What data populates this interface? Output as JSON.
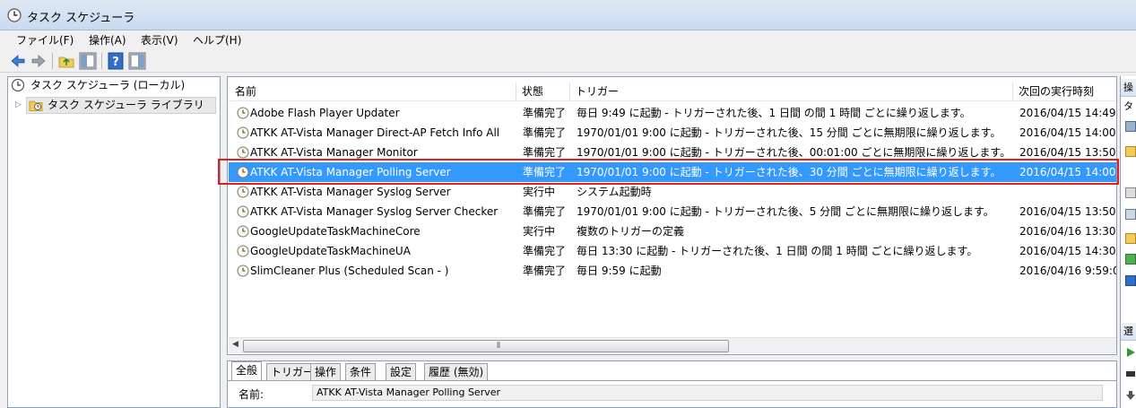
{
  "window": {
    "title": "タスク スケジューラ"
  },
  "menu": [
    "ファイル(F)",
    "操作(A)",
    "表示(V)",
    "ヘルプ(H)"
  ],
  "toolbar": [
    "back-icon",
    "forward-icon",
    "up-folder-icon",
    "show-hide-console-tree-icon",
    "help-icon",
    "show-hide-action-pane-icon"
  ],
  "tree": {
    "root": "タスク スケジューラ (ローカル)",
    "library": "タスク スケジューラ ライブラリ"
  },
  "columns": {
    "name": "名前",
    "status": "状態",
    "trigger": "トリガー",
    "next_run": "次回の実行時刻"
  },
  "tasks": [
    {
      "name": "Adobe Flash Player Updater",
      "status": "準備完了",
      "trigger": "毎日 9:49 に起動 - トリガーされた後、1 日間 の間 1 時間 ごとに繰り返します。",
      "next_run": "2016/04/15 14:49"
    },
    {
      "name": "ATKK AT-Vista Manager Direct-AP Fetch Info All",
      "status": "準備完了",
      "trigger": "1970/01/01 9:00 に起動 - トリガーされた後、15 分間 ごとに無期限に繰り返します。",
      "next_run": "2016/04/15 14:00"
    },
    {
      "name": "ATKK AT-Vista Manager Monitor",
      "status": "準備完了",
      "trigger": "1970/01/01 9:00 に起動 - トリガーされた後、00:01:00 ごとに無期限に繰り返します。",
      "next_run": "2016/04/15 13:50"
    },
    {
      "name": "ATKK AT-Vista Manager Polling Server",
      "status": "準備完了",
      "trigger": "1970/01/01 9:00 に起動 - トリガーされた後、30 分間 ごとに無期限に繰り返します。",
      "next_run": "2016/04/15 14:00"
    },
    {
      "name": "ATKK AT-Vista Manager Syslog Server",
      "status": "実行中",
      "trigger": "システム起動時",
      "next_run": ""
    },
    {
      "name": "ATKK AT-Vista Manager Syslog Server Checker",
      "status": "準備完了",
      "trigger": "1970/01/01 9:00 に起動 - トリガーされた後、5 分間 ごとに無期限に繰り返します。",
      "next_run": "2016/04/15 13:50"
    },
    {
      "name": "GoogleUpdateTaskMachineCore",
      "status": "実行中",
      "trigger": "複数のトリガーの定義",
      "next_run": "2016/04/16 13:30"
    },
    {
      "name": "GoogleUpdateTaskMachineUA",
      "status": "準備完了",
      "trigger": "毎日 13:30 に起動 - トリガーされた後、1 日間 の間 1 時間 ごとに繰り返します。",
      "next_run": "2016/04/15 14:30"
    },
    {
      "name": "SlimCleaner Plus (Scheduled Scan -          )",
      "status": "準備完了",
      "trigger": "毎日 9:59 に起動",
      "next_run": "2016/04/16 9:59:0"
    }
  ],
  "selected_task": "ATKK AT-Vista Manager Polling Server",
  "detail": {
    "tabs": [
      "全般",
      "トリガー",
      "操作",
      "条件",
      "設定",
      "履歴 (無効)"
    ],
    "active_tab": "全般",
    "name_label": "名前:",
    "name_value": "ATKK AT-Vista Manager Polling Server"
  },
  "actions_pane": {
    "header_1": "操",
    "header_2": "タ",
    "header_3": "選"
  },
  "colors": {
    "selection": "#3399ff",
    "highlight_box": "#e02020"
  }
}
